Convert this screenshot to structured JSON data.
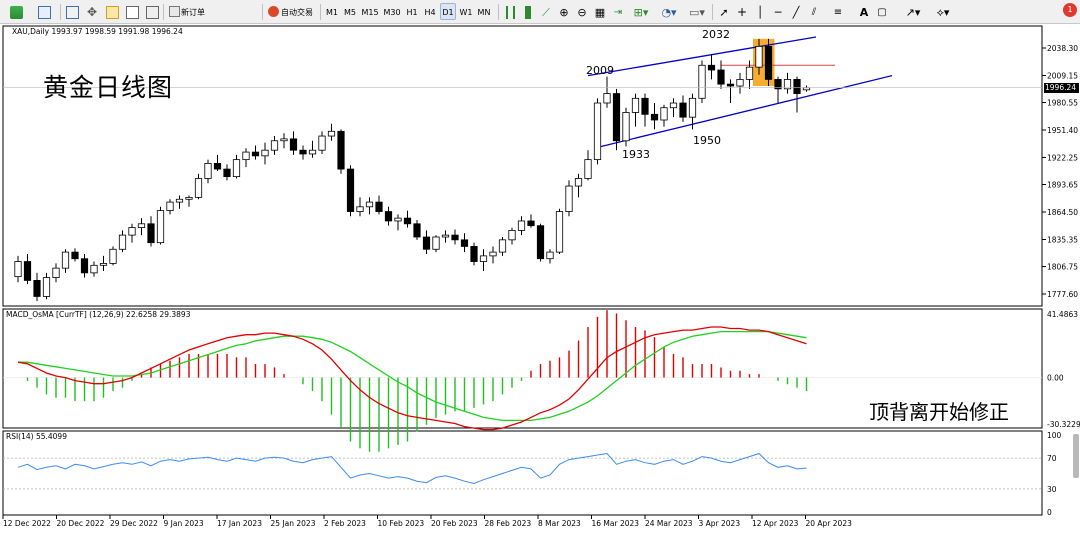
{
  "toolbar": {
    "new_order_label": "新订单",
    "auto_trading_label": "自动交易",
    "timeframes": [
      "M1",
      "M5",
      "M15",
      "M30",
      "H1",
      "H4",
      "D1",
      "W1",
      "MN"
    ],
    "active_timeframe": "D1",
    "notification_count": "1"
  },
  "chart": {
    "symbol_info": "XAU,Daily  1993.97 1998.59 1991.98 1996.24",
    "title_overlay": "黄金日线图",
    "comment_overlay": "顶背离开始修正",
    "current_price": "1996.24",
    "annotations": [
      "2009",
      "2032",
      "1933",
      "1950"
    ],
    "price_axis_labels": [
      "2038.30",
      "2009.15",
      "1980.55",
      "1951.40",
      "1922.25",
      "1893.65",
      "1864.50",
      "1835.35",
      "1806.75",
      "1777.60"
    ],
    "date_axis_labels": [
      "12 Dec 2022",
      "20 Dec 2022",
      "29 Dec 2022",
      "9 Jan 2023",
      "17 Jan 2023",
      "25 Jan 2023",
      "2 Feb 2023",
      "10 Feb 2023",
      "20 Feb 2023",
      "28 Feb 2023",
      "8 Mar 2023",
      "16 Mar 2023",
      "24 Mar 2023",
      "3 Apr 2023",
      "12 Apr 2023",
      "20 Apr 2023"
    ],
    "colors": {
      "bull": "#ffffff",
      "bear": "#000000",
      "channel": "#0000c8",
      "highlight": "#f5a31a",
      "resistance": "#e04040"
    }
  },
  "macd": {
    "label": "MACD_OsMA [CurrTF] (12,26,9) 22.6258 29.3893",
    "axis_labels": [
      "41.4863",
      "0.00",
      "-30.3229"
    ],
    "colors": {
      "main": "#e00000",
      "signal": "#20d020",
      "hist_pos": "#e00000",
      "hist_neg": "#20c020"
    }
  },
  "rsi": {
    "label": "RSI(14) 55.4099",
    "axis_labels": [
      "100",
      "70",
      "30",
      "0"
    ],
    "color": "#3c8cf0"
  },
  "chart_data": {
    "type": "candlestick",
    "ohlc": [
      [
        1796,
        1818,
        1790,
        1812
      ],
      [
        1812,
        1820,
        1788,
        1792
      ],
      [
        1792,
        1800,
        1770,
        1775
      ],
      [
        1775,
        1800,
        1772,
        1795
      ],
      [
        1795,
        1810,
        1790,
        1805
      ],
      [
        1805,
        1825,
        1800,
        1822
      ],
      [
        1822,
        1826,
        1812,
        1815
      ],
      [
        1815,
        1820,
        1795,
        1800
      ],
      [
        1800,
        1812,
        1796,
        1808
      ],
      [
        1808,
        1818,
        1802,
        1810
      ],
      [
        1810,
        1828,
        1808,
        1825
      ],
      [
        1825,
        1845,
        1822,
        1840
      ],
      [
        1840,
        1852,
        1832,
        1848
      ],
      [
        1848,
        1858,
        1840,
        1852
      ],
      [
        1852,
        1860,
        1828,
        1832
      ],
      [
        1832,
        1870,
        1830,
        1866
      ],
      [
        1866,
        1878,
        1862,
        1875
      ],
      [
        1875,
        1882,
        1868,
        1878
      ],
      [
        1878,
        1882,
        1870,
        1880
      ],
      [
        1880,
        1905,
        1878,
        1900
      ],
      [
        1900,
        1920,
        1895,
        1916
      ],
      [
        1916,
        1925,
        1908,
        1910
      ],
      [
        1910,
        1915,
        1898,
        1902
      ],
      [
        1902,
        1925,
        1900,
        1920
      ],
      [
        1920,
        1932,
        1912,
        1928
      ],
      [
        1928,
        1935,
        1920,
        1924
      ],
      [
        1924,
        1938,
        1915,
        1930
      ],
      [
        1930,
        1945,
        1925,
        1940
      ],
      [
        1940,
        1948,
        1932,
        1942
      ],
      [
        1942,
        1950,
        1925,
        1930
      ],
      [
        1930,
        1935,
        1920,
        1926
      ],
      [
        1926,
        1940,
        1922,
        1930
      ],
      [
        1930,
        1950,
        1926,
        1945
      ],
      [
        1945,
        1958,
        1940,
        1950
      ],
      [
        1950,
        1952,
        1905,
        1910
      ],
      [
        1910,
        1914,
        1860,
        1865
      ],
      [
        1865,
        1880,
        1860,
        1870
      ],
      [
        1870,
        1880,
        1862,
        1875
      ],
      [
        1875,
        1882,
        1862,
        1865
      ],
      [
        1865,
        1870,
        1850,
        1855
      ],
      [
        1855,
        1862,
        1845,
        1858
      ],
      [
        1858,
        1866,
        1848,
        1852
      ],
      [
        1852,
        1856,
        1835,
        1838
      ],
      [
        1838,
        1845,
        1820,
        1825
      ],
      [
        1825,
        1840,
        1822,
        1838
      ],
      [
        1838,
        1845,
        1832,
        1840
      ],
      [
        1840,
        1846,
        1830,
        1835
      ],
      [
        1835,
        1842,
        1822,
        1828
      ],
      [
        1828,
        1832,
        1808,
        1812
      ],
      [
        1812,
        1825,
        1802,
        1818
      ],
      [
        1818,
        1828,
        1810,
        1822
      ],
      [
        1822,
        1838,
        1818,
        1835
      ],
      [
        1835,
        1848,
        1830,
        1845
      ],
      [
        1845,
        1860,
        1840,
        1855
      ],
      [
        1855,
        1862,
        1848,
        1850
      ],
      [
        1850,
        1852,
        1812,
        1815
      ],
      [
        1815,
        1825,
        1810,
        1822
      ],
      [
        1822,
        1868,
        1820,
        1865
      ],
      [
        1865,
        1898,
        1860,
        1892
      ],
      [
        1892,
        1905,
        1880,
        1900
      ],
      [
        1900,
        1930,
        1898,
        1920
      ],
      [
        1920,
        1985,
        1915,
        1980
      ],
      [
        1980,
        2008,
        1975,
        1990
      ],
      [
        1990,
        1995,
        1930,
        1940
      ],
      [
        1940,
        1975,
        1934,
        1970
      ],
      [
        1970,
        1990,
        1955,
        1985
      ],
      [
        1985,
        1990,
        1955,
        1968
      ],
      [
        1968,
        1980,
        1952,
        1962
      ],
      [
        1962,
        1978,
        1955,
        1975
      ],
      [
        1975,
        1985,
        1965,
        1980
      ],
      [
        1980,
        1988,
        1960,
        1965
      ],
      [
        1965,
        1990,
        1952,
        1985
      ],
      [
        1985,
        2025,
        1980,
        2020
      ],
      [
        2020,
        2032,
        2005,
        2015
      ],
      [
        2015,
        2025,
        1995,
        2000
      ],
      [
        2000,
        2005,
        1980,
        1998
      ],
      [
        1998,
        2012,
        1990,
        2005
      ],
      [
        2005,
        2025,
        1995,
        2018
      ],
      [
        2018,
        2048,
        2010,
        2040
      ],
      [
        2040,
        2048,
        1998,
        2005
      ],
      [
        2005,
        2008,
        1980,
        1995
      ],
      [
        1995,
        2012,
        1990,
        2005
      ],
      [
        2005,
        2008,
        1970,
        1990
      ],
      [
        1993.97,
        1998.59,
        1991.98,
        1996.24
      ]
    ],
    "price_range": [
      1777.6,
      2038.3
    ],
    "channel_upper": [
      [
        60,
        2009
      ],
      [
        84,
        2050
      ]
    ],
    "channel_lower": [
      [
        61,
        1933
      ],
      [
        92,
        2009
      ]
    ],
    "resistance": 2020,
    "highlight_bars": [
      78,
      79
    ],
    "macd_main": [
      10,
      9,
      6,
      3,
      1,
      0,
      -2,
      -3,
      -4,
      -4,
      -3,
      -2,
      0,
      3,
      6,
      9,
      12,
      15,
      18,
      20,
      22,
      24,
      26,
      27,
      28,
      28,
      29,
      29,
      28,
      27,
      25,
      22,
      18,
      12,
      5,
      -2,
      -8,
      -13,
      -17,
      -20,
      -23,
      -25,
      -26,
      -27,
      -28,
      -29,
      -30,
      -32,
      -33,
      -34,
      -34,
      -33,
      -31,
      -29,
      -26,
      -23,
      -21,
      -18,
      -14,
      -8,
      -1,
      6,
      13,
      17,
      20,
      23,
      26,
      28,
      29,
      30,
      31,
      31,
      32,
      33,
      33,
      32,
      32,
      31,
      31,
      30,
      28,
      26,
      24,
      22
    ],
    "macd_signal": [
      10,
      10,
      9,
      8,
      7,
      6,
      5,
      4,
      3,
      2,
      1,
      1,
      1,
      2,
      3,
      5,
      7,
      9,
      11,
      13,
      15,
      17,
      19,
      21,
      22,
      24,
      25,
      26,
      27,
      27,
      27,
      26,
      25,
      23,
      20,
      17,
      13,
      9,
      5,
      1,
      -3,
      -6,
      -10,
      -13,
      -16,
      -18,
      -20,
      -22,
      -24,
      -26,
      -27,
      -28,
      -28,
      -28,
      -28,
      -27,
      -26,
      -24,
      -22,
      -19,
      -16,
      -12,
      -7,
      -2,
      3,
      8,
      12,
      16,
      20,
      23,
      25,
      27,
      28,
      29,
      30,
      30,
      30,
      30,
      30,
      30,
      29,
      28,
      27,
      26
    ],
    "rsi": [
      58,
      62,
      55,
      58,
      60,
      56,
      62,
      60,
      56,
      59,
      62,
      64,
      62,
      65,
      60,
      66,
      68,
      66,
      69,
      70,
      71,
      68,
      66,
      70,
      68,
      66,
      70,
      71,
      70,
      66,
      64,
      68,
      70,
      72,
      58,
      44,
      48,
      50,
      47,
      44,
      46,
      44,
      40,
      38,
      45,
      47,
      44,
      40,
      37,
      42,
      46,
      50,
      54,
      58,
      56,
      44,
      48,
      62,
      68,
      70,
      72,
      74,
      76,
      62,
      66,
      68,
      64,
      62,
      66,
      68,
      62,
      66,
      72,
      70,
      66,
      64,
      68,
      72,
      76,
      64,
      58,
      60,
      56,
      57
    ],
    "price_ticks": [
      2038.3,
      2009.15,
      1980.55,
      1951.4,
      1922.25,
      1893.65,
      1864.5,
      1835.35,
      1806.75,
      1777.6
    ],
    "macd_range": [
      -30.3229,
      41.4863
    ],
    "rsi_range": [
      0,
      100
    ],
    "rsi_levels": [
      70,
      30
    ]
  }
}
